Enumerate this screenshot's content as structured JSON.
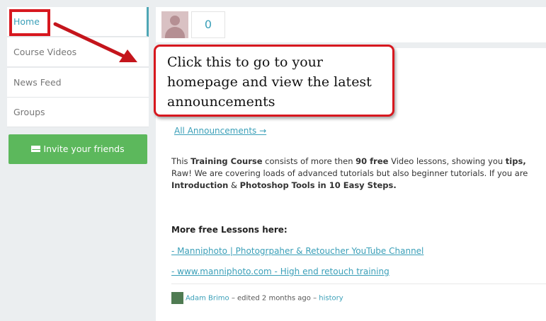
{
  "sidebar": {
    "items": [
      {
        "label": "Home",
        "active": true
      },
      {
        "label": "Course Videos"
      },
      {
        "label": "News Feed"
      },
      {
        "label": "Groups"
      }
    ],
    "invite_label": "Invite your friends",
    "invite_icon": "envelope-icon"
  },
  "topbar": {
    "count": "0",
    "avatar_icon": "user-avatar"
  },
  "callout": {
    "text": "Click this to go to your homepage and view the latest announcements"
  },
  "main": {
    "all_announcements": "All Announcements →",
    "description": {
      "p1": "This ",
      "b1": "Training Course",
      "p2": " consists of more then ",
      "b2": "90 free",
      "p3": " Video lessons, showing you ",
      "b3": "tips,",
      "line2": "Raw! We are covering loads of advanced tutorials but also beginner tutorials. If you are",
      "b4": "Introduction",
      "p4": " & ",
      "b5": "Photoshop Tools in 10 Easy Steps."
    },
    "more_title": "More free Lessons here:",
    "links": [
      "- Manniphoto | Photogrpaher & Retoucher YouTube Channel",
      "- www.manniphoto.com - High end retouch training"
    ],
    "author": {
      "name": "Adam Brimo",
      "edited": " – edited 2 months ago – ",
      "history": "history"
    }
  },
  "colors": {
    "accent": "#3a9fb8",
    "annotation_red": "#d7181f",
    "invite_green": "#5cb85c"
  }
}
